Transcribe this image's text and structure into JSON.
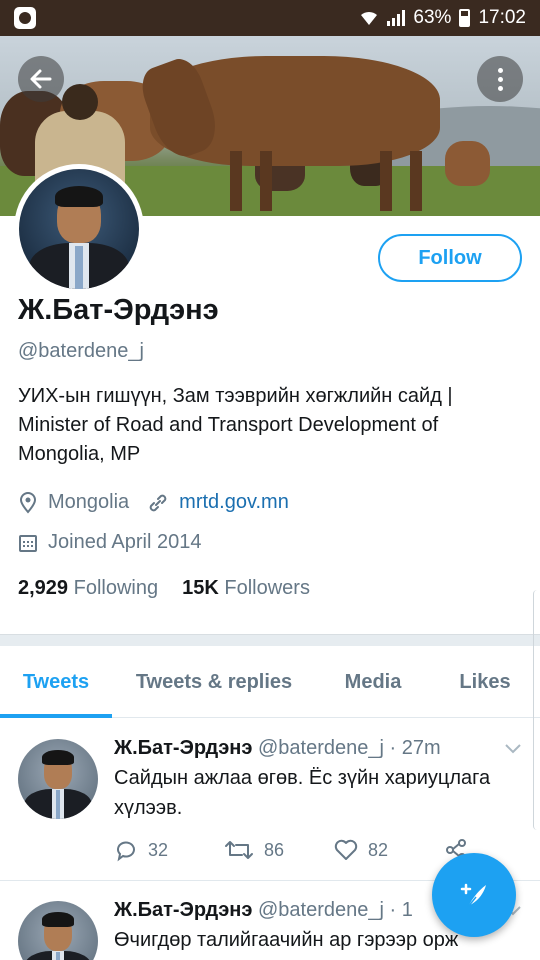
{
  "status_bar": {
    "battery": "63%",
    "time": "17:02"
  },
  "profile": {
    "name": "Ж.Бат-Эрдэнэ",
    "handle": "@baterdene_j",
    "bio": "УИХ-ын гишүүн, Зам тээврийн хөгжлийн сайд | Minister of Road and Transport Development of Mongolia, MP",
    "location": "Mongolia",
    "website": "mrtd.gov.mn",
    "joined": "Joined April 2014",
    "following_count": "2,929",
    "following_label": "Following",
    "followers_count": "15K",
    "followers_label": "Followers",
    "follow_button": "Follow"
  },
  "tabs": [
    {
      "label": "Tweets",
      "active": true
    },
    {
      "label": "Tweets & replies",
      "active": false
    },
    {
      "label": "Media",
      "active": false
    },
    {
      "label": "Likes",
      "active": false
    }
  ],
  "tweets": [
    {
      "name": "Ж.Бат-Эрдэнэ",
      "handle": "@baterdene_j",
      "time": "· 27m",
      "text": "Сайдын ажлаа өгөв. Ёс зүйн хариуцлага хүлээв.",
      "replies": "32",
      "retweets": "86",
      "likes": "82"
    },
    {
      "name": "Ж.Бат-Эрдэнэ",
      "handle": "@baterdene_j",
      "time": "· 1",
      "text": "Өчигдөр талийгаачийн ар гэрээр орж"
    }
  ],
  "colors": {
    "accent": "#1da1f2",
    "muted": "#657786",
    "link": "#1b6fb0"
  },
  "icons": {
    "back": "back-arrow-icon",
    "more": "more-vertical-icon",
    "location": "location-pin-icon",
    "link": "link-icon",
    "calendar": "calendar-icon",
    "reply": "reply-icon",
    "retweet": "retweet-icon",
    "like": "heart-icon",
    "share": "share-icon",
    "compose": "compose-tweet-icon"
  }
}
